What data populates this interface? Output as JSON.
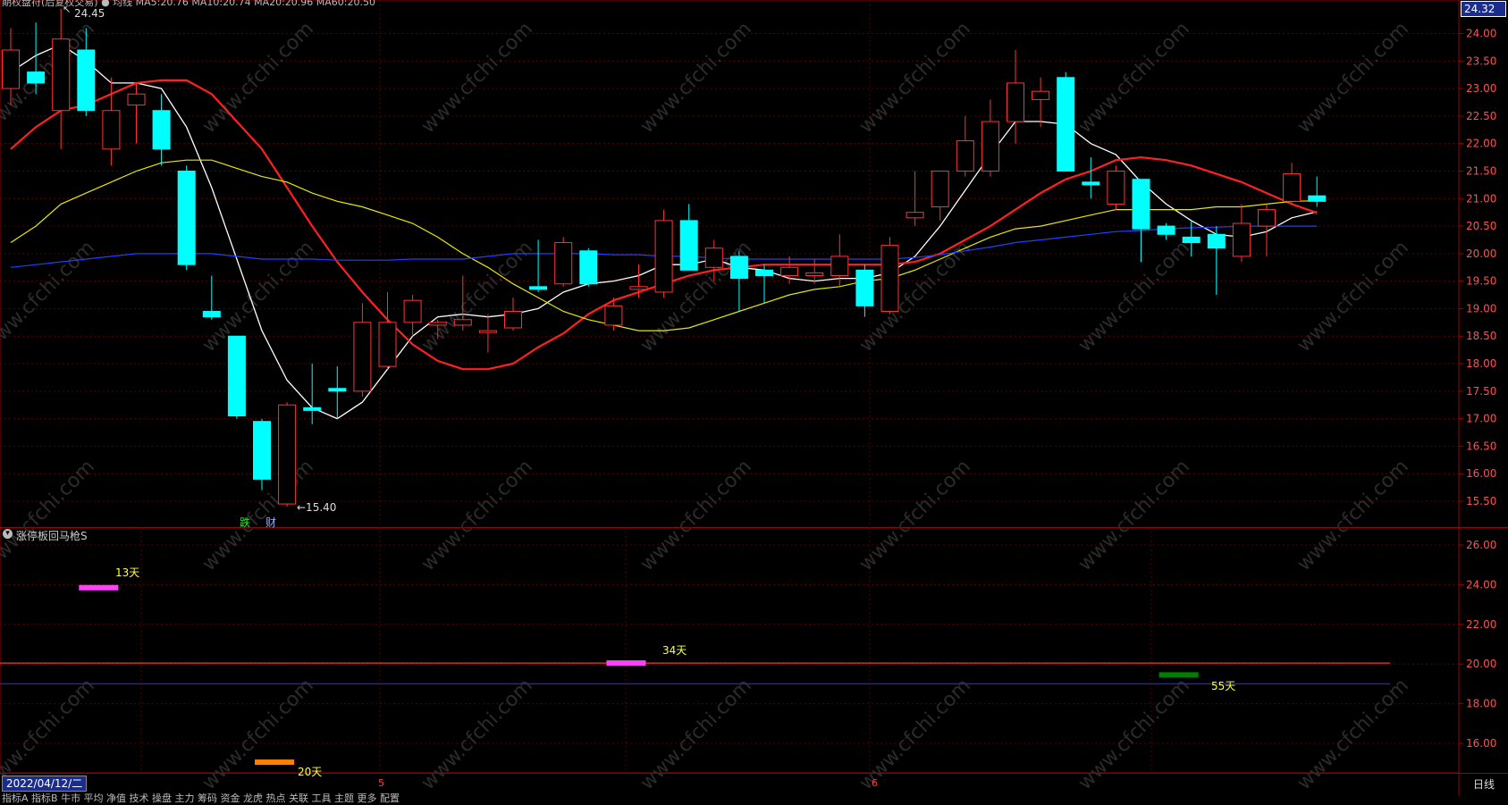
{
  "main_panel": {
    "title_text": "期权盘符(后复权交易)  ● 均线 MA5:20.76  MA10:20.74  MA20:20.96  MA60:20.50",
    "price_tag": "24.32",
    "high_label": "24.45",
    "low_label": "←15.40",
    "badges": [
      "跌",
      "财"
    ]
  },
  "indicator_panel": {
    "title": "涨停板回马枪S",
    "day_labels": [
      "13天",
      "34天",
      "55天",
      "20天"
    ]
  },
  "footer": {
    "date": "2022/04/12/二",
    "month_marks": [
      "5",
      "6"
    ],
    "period": "日线",
    "tabs_text": "指标A  指标B  牛市  平均  净值  技术  操盘  主力  筹码  资金  龙虎  热点  关联  工具  主题  更多  配置"
  },
  "watermark": "www.cfchi.com",
  "colors": {
    "up": "#ff3232",
    "down": "#00ffff",
    "ma5": "#ffffff",
    "ma10": "#ff2020",
    "ma20": "#e8e800",
    "ma60": "#2040ff",
    "grid": "#5a0000"
  },
  "chart_data": [
    {
      "type": "candlestick",
      "y_ticks": [
        "24.00",
        "23.50",
        "23.00",
        "22.50",
        "22.00",
        "21.50",
        "21.00",
        "20.50",
        "20.00",
        "19.50",
        "19.00",
        "18.50",
        "18.00",
        "17.50",
        "17.00",
        "16.50",
        "16.00",
        "15.50"
      ],
      "ylim": [
        15.2,
        24.3
      ],
      "candles": [
        {
          "o": 23.0,
          "h": 24.1,
          "l": 22.7,
          "c": 23.7
        },
        {
          "o": 23.3,
          "h": 24.2,
          "l": 22.9,
          "c": 23.1
        },
        {
          "o": 22.6,
          "h": 24.45,
          "l": 21.9,
          "c": 23.9
        },
        {
          "o": 23.7,
          "h": 24.1,
          "l": 22.5,
          "c": 22.6
        },
        {
          "o": 21.9,
          "h": 23.2,
          "l": 21.6,
          "c": 22.6
        },
        {
          "o": 22.7,
          "h": 23.1,
          "l": 22.0,
          "c": 22.9
        },
        {
          "o": 22.6,
          "h": 22.9,
          "l": 21.6,
          "c": 21.9
        },
        {
          "o": 21.5,
          "h": 21.6,
          "l": 19.7,
          "c": 19.8
        },
        {
          "o": 18.95,
          "h": 19.6,
          "l": 18.8,
          "c": 18.85
        },
        {
          "o": 18.5,
          "h": 18.5,
          "l": 17.0,
          "c": 17.05
        },
        {
          "o": 16.95,
          "h": 17.0,
          "l": 15.7,
          "c": 15.9
        },
        {
          "o": 15.45,
          "h": 17.3,
          "l": 15.4,
          "c": 17.25
        },
        {
          "o": 17.2,
          "h": 18.0,
          "l": 16.9,
          "c": 17.15
        },
        {
          "o": 17.55,
          "h": 17.95,
          "l": 17.0,
          "c": 17.5
        },
        {
          "o": 17.5,
          "h": 19.1,
          "l": 17.4,
          "c": 18.75
        },
        {
          "o": 17.95,
          "h": 19.3,
          "l": 17.9,
          "c": 18.75
        },
        {
          "o": 18.75,
          "h": 19.25,
          "l": 18.5,
          "c": 19.15
        },
        {
          "o": 18.7,
          "h": 18.8,
          "l": 18.45,
          "c": 18.75
        },
        {
          "o": 18.7,
          "h": 19.6,
          "l": 18.6,
          "c": 18.8
        },
        {
          "o": 18.6,
          "h": 18.9,
          "l": 18.2,
          "c": 18.6
        },
        {
          "o": 18.65,
          "h": 19.2,
          "l": 18.6,
          "c": 18.95
        },
        {
          "o": 19.4,
          "h": 20.25,
          "l": 19.3,
          "c": 19.35
        },
        {
          "o": 19.45,
          "h": 20.3,
          "l": 19.4,
          "c": 20.2
        },
        {
          "o": 20.05,
          "h": 20.1,
          "l": 19.4,
          "c": 19.45
        },
        {
          "o": 18.7,
          "h": 19.2,
          "l": 18.6,
          "c": 19.05
        },
        {
          "o": 19.35,
          "h": 19.8,
          "l": 19.2,
          "c": 19.4
        },
        {
          "o": 19.3,
          "h": 20.8,
          "l": 19.2,
          "c": 20.6
        },
        {
          "o": 20.6,
          "h": 20.9,
          "l": 19.7,
          "c": 19.7
        },
        {
          "o": 19.75,
          "h": 20.25,
          "l": 19.5,
          "c": 20.1
        },
        {
          "o": 19.95,
          "h": 20.05,
          "l": 18.95,
          "c": 19.55
        },
        {
          "o": 19.7,
          "h": 19.8,
          "l": 19.1,
          "c": 19.6
        },
        {
          "o": 19.6,
          "h": 19.95,
          "l": 19.45,
          "c": 19.75
        },
        {
          "o": 19.6,
          "h": 19.9,
          "l": 19.45,
          "c": 19.65
        },
        {
          "o": 19.6,
          "h": 20.35,
          "l": 19.4,
          "c": 19.95
        },
        {
          "o": 19.7,
          "h": 19.8,
          "l": 18.85,
          "c": 19.05
        },
        {
          "o": 18.95,
          "h": 20.3,
          "l": 18.9,
          "c": 20.15
        },
        {
          "o": 20.65,
          "h": 21.5,
          "l": 20.5,
          "c": 20.75
        },
        {
          "o": 20.85,
          "h": 21.5,
          "l": 20.6,
          "c": 21.5
        },
        {
          "o": 21.5,
          "h": 22.5,
          "l": 21.4,
          "c": 22.05
        },
        {
          "o": 21.5,
          "h": 22.8,
          "l": 21.4,
          "c": 22.4
        },
        {
          "o": 22.4,
          "h": 23.7,
          "l": 22.0,
          "c": 23.1
        },
        {
          "o": 22.8,
          "h": 23.2,
          "l": 22.3,
          "c": 22.95
        },
        {
          "o": 23.2,
          "h": 23.3,
          "l": 21.5,
          "c": 21.5
        },
        {
          "o": 21.3,
          "h": 21.75,
          "l": 21.0,
          "c": 21.25
        },
        {
          "o": 20.9,
          "h": 21.6,
          "l": 20.8,
          "c": 21.5
        },
        {
          "o": 21.35,
          "h": 21.35,
          "l": 19.85,
          "c": 20.45
        },
        {
          "o": 20.5,
          "h": 20.55,
          "l": 20.25,
          "c": 20.35
        },
        {
          "o": 20.3,
          "h": 20.6,
          "l": 19.95,
          "c": 20.2
        },
        {
          "o": 20.35,
          "h": 20.5,
          "l": 19.25,
          "c": 20.1
        },
        {
          "o": 19.95,
          "h": 20.9,
          "l": 19.85,
          "c": 20.55
        },
        {
          "o": 20.5,
          "h": 20.9,
          "l": 19.95,
          "c": 20.8
        },
        {
          "o": 20.95,
          "h": 21.65,
          "l": 20.9,
          "c": 21.45
        },
        {
          "o": 21.05,
          "h": 21.4,
          "l": 20.85,
          "c": 20.95
        }
      ],
      "ma_series": [
        {
          "key": "ma5",
          "values": [
            23.3,
            23.6,
            23.8,
            23.5,
            23.1,
            23.1,
            23.0,
            22.3,
            21.2,
            19.9,
            18.6,
            17.7,
            17.2,
            17.0,
            17.3,
            17.9,
            18.5,
            18.85,
            18.9,
            18.85,
            18.9,
            19.0,
            19.3,
            19.45,
            19.5,
            19.6,
            19.8,
            19.8,
            19.9,
            19.75,
            19.7,
            19.55,
            19.5,
            19.55,
            19.55,
            19.65,
            19.95,
            20.5,
            21.15,
            21.8,
            22.4,
            22.4,
            22.35,
            22.0,
            21.8,
            21.3,
            20.9,
            20.6,
            20.35,
            20.3,
            20.4,
            20.65,
            20.76
          ]
        },
        {
          "key": "ma10",
          "values": [
            21.9,
            22.3,
            22.6,
            22.7,
            22.9,
            23.1,
            23.15,
            23.15,
            22.9,
            22.4,
            21.9,
            21.2,
            20.5,
            19.85,
            19.3,
            18.8,
            18.35,
            18.05,
            17.9,
            17.9,
            18.0,
            18.3,
            18.55,
            18.9,
            19.15,
            19.3,
            19.45,
            19.6,
            19.7,
            19.75,
            19.8,
            19.8,
            19.8,
            19.8,
            19.8,
            19.8,
            19.85,
            20.0,
            20.25,
            20.5,
            20.8,
            21.1,
            21.35,
            21.5,
            21.7,
            21.75,
            21.7,
            21.6,
            21.45,
            21.3,
            21.1,
            20.9,
            20.74
          ]
        },
        {
          "key": "ma20",
          "values": [
            20.2,
            20.5,
            20.9,
            21.1,
            21.3,
            21.5,
            21.65,
            21.7,
            21.7,
            21.55,
            21.4,
            21.3,
            21.1,
            20.95,
            20.85,
            20.7,
            20.55,
            20.3,
            20.0,
            19.75,
            19.45,
            19.2,
            18.95,
            18.8,
            18.7,
            18.6,
            18.6,
            18.65,
            18.8,
            18.95,
            19.1,
            19.25,
            19.35,
            19.4,
            19.5,
            19.55,
            19.7,
            19.9,
            20.1,
            20.3,
            20.45,
            20.5,
            20.6,
            20.7,
            20.8,
            20.8,
            20.8,
            20.8,
            20.85,
            20.85,
            20.9,
            20.95,
            20.96
          ]
        },
        {
          "key": "ma60",
          "values": [
            19.75,
            19.8,
            19.85,
            19.9,
            19.95,
            20.0,
            20.0,
            20.0,
            20.0,
            19.95,
            19.9,
            19.9,
            19.9,
            19.88,
            19.88,
            19.88,
            19.9,
            19.9,
            19.9,
            19.95,
            20.0,
            20.0,
            20.0,
            20.0,
            19.98,
            19.98,
            19.95,
            19.95,
            19.92,
            19.9,
            19.9,
            19.9,
            19.9,
            19.9,
            19.9,
            19.9,
            19.93,
            19.98,
            20.05,
            20.12,
            20.2,
            20.25,
            20.3,
            20.35,
            20.4,
            20.42,
            20.45,
            20.47,
            20.48,
            20.5,
            20.5,
            20.5,
            20.5
          ]
        }
      ]
    },
    {
      "type": "bar",
      "y_ticks": [
        "26.00",
        "24.00",
        "22.00",
        "20.00",
        "18.00",
        "16.00"
      ],
      "ylim": [
        14.5,
        27.0
      ],
      "hlines": [
        {
          "y": 20.05,
          "color": "#ff3030"
        },
        {
          "y": 19.0,
          "color": "#2020ff"
        }
      ],
      "segments": [
        {
          "start_idx": 3,
          "end_idx": 4,
          "y": 23.85,
          "color": "#ff40ff",
          "label_idx": 0
        },
        {
          "start_idx": 24,
          "end_idx": 25,
          "y": 20.05,
          "color": "#ff40ff",
          "label_idx": 1
        },
        {
          "start_idx": 46,
          "end_idx": 47,
          "y": 19.45,
          "color": "#008000",
          "label_idx": 2
        },
        {
          "start_idx": 10,
          "end_idx": 11,
          "y": 15.05,
          "color": "#ff8000",
          "label_idx": 3
        }
      ]
    }
  ]
}
